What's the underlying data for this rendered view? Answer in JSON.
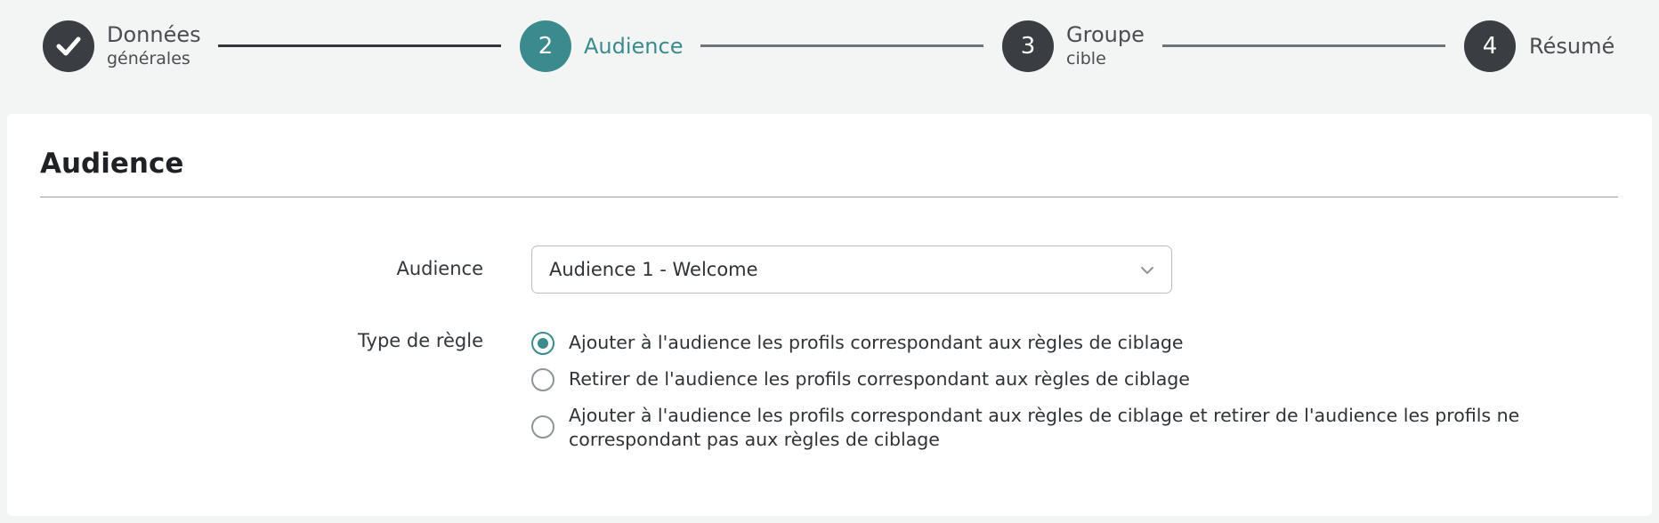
{
  "colors": {
    "accent": "#3b8a8d",
    "step_default": "#3a3d41",
    "background": "#f3f5f4"
  },
  "stepper": {
    "steps": [
      {
        "number": "",
        "icon": "check-icon",
        "title": "Données",
        "subtitle": "générales",
        "state": "completed"
      },
      {
        "number": "2",
        "title": "Audience",
        "subtitle": "",
        "state": "active"
      },
      {
        "number": "3",
        "title": "Groupe",
        "subtitle": "cible",
        "state": "pending"
      },
      {
        "number": "4",
        "title": "Résumé",
        "subtitle": "",
        "state": "pending"
      }
    ]
  },
  "card": {
    "title": "Audience",
    "audience_field": {
      "label": "Audience",
      "value": "Audience 1 - Welcome",
      "icon": "chevron-down-icon"
    },
    "rule_type_field": {
      "label": "Type de règle",
      "options": [
        {
          "label": "Ajouter à l'audience les profils correspondant aux règles de ciblage",
          "selected": true
        },
        {
          "label": "Retirer de l'audience les profils correspondant aux règles de ciblage",
          "selected": false
        },
        {
          "label_line1": "Ajouter à l'audience les profils correspondant aux règles de ciblage et retirer de l'audience les profils ne",
          "label_line2": "correspondant pas aux règles de ciblage",
          "selected": false
        }
      ]
    }
  }
}
